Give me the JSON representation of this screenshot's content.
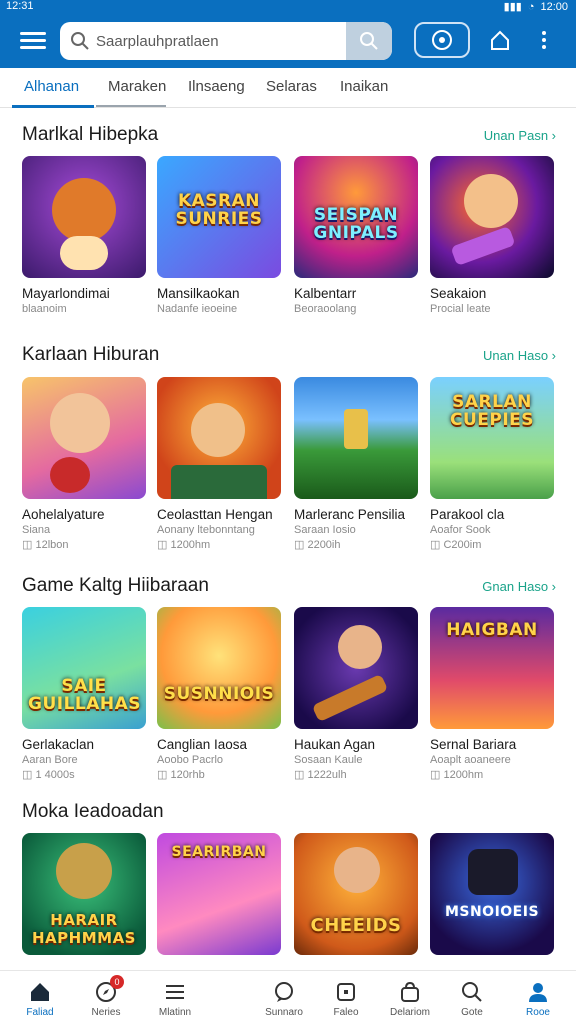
{
  "status": {
    "time": "12:31",
    "clock_right": "12:00"
  },
  "search": {
    "placeholder": "Saarplauhpratlaen"
  },
  "tabs": [
    {
      "label": "Alhanan"
    },
    {
      "label": "Maraken"
    },
    {
      "label": "Ilnsaeng"
    },
    {
      "label": "Selaras"
    },
    {
      "label": "Inaikan"
    }
  ],
  "sections": [
    {
      "title": "Marlkal Hibepka",
      "link": "Unan Pasn ›",
      "cards": [
        {
          "name": "Mayarlondimai",
          "sub": "blaanoim",
          "meta": "",
          "logo": ""
        },
        {
          "name": "Mansilkaokan",
          "sub": "Nadanfe ieoeine",
          "meta": "",
          "logo": "KASRAN SUNRIES"
        },
        {
          "name": "Kalbentarr",
          "sub": "Beoraoolang",
          "meta": "",
          "logo": "SEISPAN GNIPALS"
        },
        {
          "name": "Seakaion",
          "sub": "Procial leate",
          "meta": "",
          "logo": ""
        }
      ]
    },
    {
      "title": "Karlaan Hiburan",
      "link": "Unan Haso ›",
      "cards": [
        {
          "name": "Aohelalyature",
          "sub": "Siana",
          "meta": "12lbon",
          "logo": ""
        },
        {
          "name": "Ceolasttan Hengan",
          "sub": "Aonany ltebonntang",
          "meta": "1200hm",
          "logo": ""
        },
        {
          "name": "Marleranc Pensilia",
          "sub": "Saraan Iosio",
          "meta": "2200ih",
          "logo": ""
        },
        {
          "name": "Parakool cla",
          "sub": "Aoafor Sook",
          "meta": "C200im",
          "logo": "SARLAN CUEPIES"
        }
      ]
    },
    {
      "title": "Game Kaltg Hiibaraan",
      "link": "Gnan Haso ›",
      "cards": [
        {
          "name": "Gerlakaclan",
          "sub": "Aaran Bore",
          "meta": "1 4000s",
          "logo": "SAIE GUILLAHAS"
        },
        {
          "name": "Canglian Iaosa",
          "sub": "Aoobo Pacrlo",
          "meta": "120rhb",
          "logo": "SUSNNIOIS"
        },
        {
          "name": "Haukan Agan",
          "sub": "Sosaan Kaule",
          "meta": "1222ulh",
          "logo": ""
        },
        {
          "name": "Sernal Bariara",
          "sub": "Aoaplt aoaneere",
          "meta": "1200hm",
          "logo": "HAIGBAN"
        }
      ]
    },
    {
      "title": "Moka Ieadoadan",
      "link": "",
      "cards": [
        {
          "name": "",
          "sub": "",
          "meta": "",
          "logo": "HARAIR HAPHMMAS"
        },
        {
          "name": "",
          "sub": "",
          "meta": "",
          "logo": "SEARIRBAN"
        },
        {
          "name": "",
          "sub": "",
          "meta": "",
          "logo": "CHEEIDS"
        },
        {
          "name": "",
          "sub": "",
          "meta": "",
          "logo": "MSNOIOEIS"
        }
      ]
    }
  ],
  "bottom_nav": [
    {
      "label": "Faliad",
      "icon": "home-icon"
    },
    {
      "label": "Neries",
      "icon": "compass-icon",
      "badge": "0"
    },
    {
      "label": "Mlatinn",
      "icon": "list-icon"
    },
    {
      "label": "Sunnaro",
      "icon": "chat-icon"
    },
    {
      "label": "Faleo",
      "icon": "card-icon"
    },
    {
      "label": "Delariom",
      "icon": "bag-icon"
    },
    {
      "label": "Gote",
      "icon": "search-icon"
    },
    {
      "label": "Rooe",
      "icon": "profile-icon"
    }
  ],
  "colors": {
    "brand": "#0a6fbf",
    "link": "#1aa38a",
    "badge": "#d62828"
  }
}
